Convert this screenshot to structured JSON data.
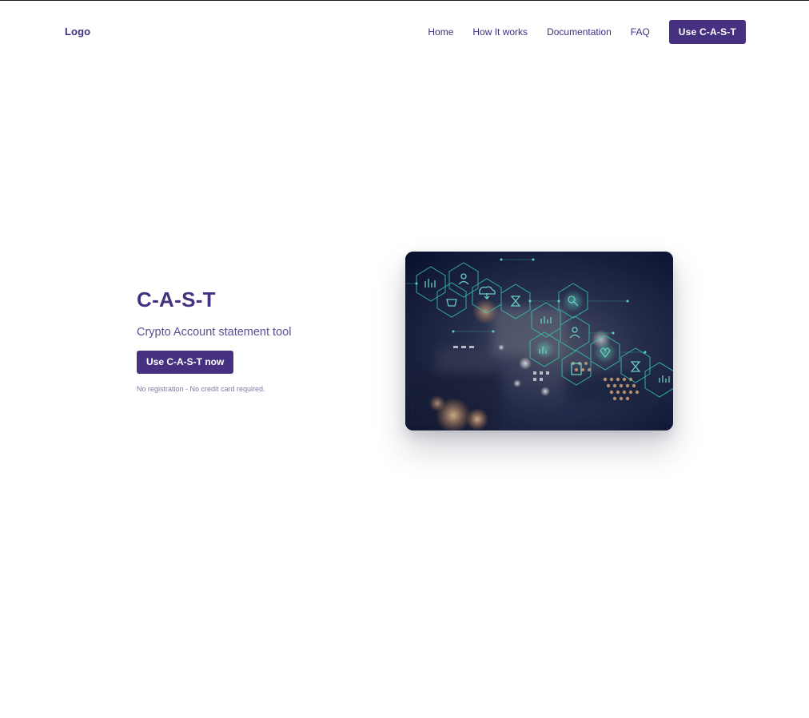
{
  "header": {
    "logo": "Logo",
    "nav": [
      {
        "label": "Home"
      },
      {
        "label": "How It works"
      },
      {
        "label": "Documentation"
      },
      {
        "label": "FAQ"
      }
    ],
    "cta_label": "Use C-A-S-T"
  },
  "hero": {
    "title": "C-A-S-T",
    "subtitle": "Crypto Account statement tool",
    "button_label": "Use C-A-S-T now",
    "note": "No registration - No credit card required."
  },
  "colors": {
    "brand": "#45317f",
    "text": "#3d2f7f",
    "note": "#7d7a9e",
    "image_glow": "#3ee6c4"
  },
  "image": {
    "icon": "circuit-board-blockchain-image"
  }
}
